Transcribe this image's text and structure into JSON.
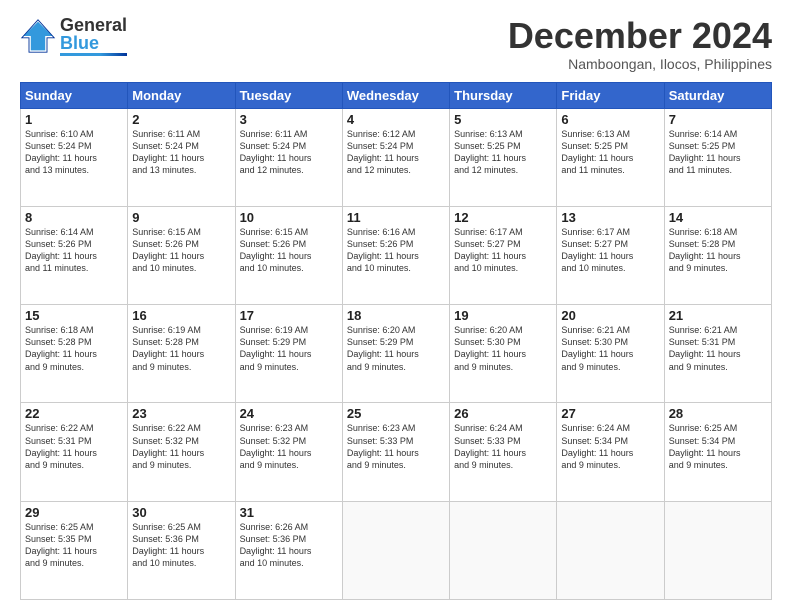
{
  "header": {
    "logo_general": "General",
    "logo_blue": "Blue",
    "month_title": "December 2024",
    "location": "Namboongan, Ilocos, Philippines"
  },
  "calendar": {
    "days_of_week": [
      "Sunday",
      "Monday",
      "Tuesday",
      "Wednesday",
      "Thursday",
      "Friday",
      "Saturday"
    ],
    "weeks": [
      [
        {
          "day": "",
          "info": ""
        },
        {
          "day": "2",
          "info": "Sunrise: 6:11 AM\nSunset: 5:24 PM\nDaylight: 11 hours\nand 13 minutes."
        },
        {
          "day": "3",
          "info": "Sunrise: 6:11 AM\nSunset: 5:24 PM\nDaylight: 11 hours\nand 12 minutes."
        },
        {
          "day": "4",
          "info": "Sunrise: 6:12 AM\nSunset: 5:24 PM\nDaylight: 11 hours\nand 12 minutes."
        },
        {
          "day": "5",
          "info": "Sunrise: 6:13 AM\nSunset: 5:25 PM\nDaylight: 11 hours\nand 12 minutes."
        },
        {
          "day": "6",
          "info": "Sunrise: 6:13 AM\nSunset: 5:25 PM\nDaylight: 11 hours\nand 11 minutes."
        },
        {
          "day": "7",
          "info": "Sunrise: 6:14 AM\nSunset: 5:25 PM\nDaylight: 11 hours\nand 11 minutes."
        }
      ],
      [
        {
          "day": "1",
          "info": "Sunrise: 6:10 AM\nSunset: 5:24 PM\nDaylight: 11 hours\nand 13 minutes."
        },
        {
          "day": "",
          "info": ""
        },
        {
          "day": "",
          "info": ""
        },
        {
          "day": "",
          "info": ""
        },
        {
          "day": "",
          "info": ""
        },
        {
          "day": "",
          "info": ""
        },
        {
          "day": "",
          "info": ""
        }
      ],
      [
        {
          "day": "8",
          "info": "Sunrise: 6:14 AM\nSunset: 5:26 PM\nDaylight: 11 hours\nand 11 minutes."
        },
        {
          "day": "9",
          "info": "Sunrise: 6:15 AM\nSunset: 5:26 PM\nDaylight: 11 hours\nand 10 minutes."
        },
        {
          "day": "10",
          "info": "Sunrise: 6:15 AM\nSunset: 5:26 PM\nDaylight: 11 hours\nand 10 minutes."
        },
        {
          "day": "11",
          "info": "Sunrise: 6:16 AM\nSunset: 5:26 PM\nDaylight: 11 hours\nand 10 minutes."
        },
        {
          "day": "12",
          "info": "Sunrise: 6:17 AM\nSunset: 5:27 PM\nDaylight: 11 hours\nand 10 minutes."
        },
        {
          "day": "13",
          "info": "Sunrise: 6:17 AM\nSunset: 5:27 PM\nDaylight: 11 hours\nand 10 minutes."
        },
        {
          "day": "14",
          "info": "Sunrise: 6:18 AM\nSunset: 5:28 PM\nDaylight: 11 hours\nand 9 minutes."
        }
      ],
      [
        {
          "day": "15",
          "info": "Sunrise: 6:18 AM\nSunset: 5:28 PM\nDaylight: 11 hours\nand 9 minutes."
        },
        {
          "day": "16",
          "info": "Sunrise: 6:19 AM\nSunset: 5:28 PM\nDaylight: 11 hours\nand 9 minutes."
        },
        {
          "day": "17",
          "info": "Sunrise: 6:19 AM\nSunset: 5:29 PM\nDaylight: 11 hours\nand 9 minutes."
        },
        {
          "day": "18",
          "info": "Sunrise: 6:20 AM\nSunset: 5:29 PM\nDaylight: 11 hours\nand 9 minutes."
        },
        {
          "day": "19",
          "info": "Sunrise: 6:20 AM\nSunset: 5:30 PM\nDaylight: 11 hours\nand 9 minutes."
        },
        {
          "day": "20",
          "info": "Sunrise: 6:21 AM\nSunset: 5:30 PM\nDaylight: 11 hours\nand 9 minutes."
        },
        {
          "day": "21",
          "info": "Sunrise: 6:21 AM\nSunset: 5:31 PM\nDaylight: 11 hours\nand 9 minutes."
        }
      ],
      [
        {
          "day": "22",
          "info": "Sunrise: 6:22 AM\nSunset: 5:31 PM\nDaylight: 11 hours\nand 9 minutes."
        },
        {
          "day": "23",
          "info": "Sunrise: 6:22 AM\nSunset: 5:32 PM\nDaylight: 11 hours\nand 9 minutes."
        },
        {
          "day": "24",
          "info": "Sunrise: 6:23 AM\nSunset: 5:32 PM\nDaylight: 11 hours\nand 9 minutes."
        },
        {
          "day": "25",
          "info": "Sunrise: 6:23 AM\nSunset: 5:33 PM\nDaylight: 11 hours\nand 9 minutes."
        },
        {
          "day": "26",
          "info": "Sunrise: 6:24 AM\nSunset: 5:33 PM\nDaylight: 11 hours\nand 9 minutes."
        },
        {
          "day": "27",
          "info": "Sunrise: 6:24 AM\nSunset: 5:34 PM\nDaylight: 11 hours\nand 9 minutes."
        },
        {
          "day": "28",
          "info": "Sunrise: 6:25 AM\nSunset: 5:34 PM\nDaylight: 11 hours\nand 9 minutes."
        }
      ],
      [
        {
          "day": "29",
          "info": "Sunrise: 6:25 AM\nSunset: 5:35 PM\nDaylight: 11 hours\nand 9 minutes."
        },
        {
          "day": "30",
          "info": "Sunrise: 6:25 AM\nSunset: 5:36 PM\nDaylight: 11 hours\nand 10 minutes."
        },
        {
          "day": "31",
          "info": "Sunrise: 6:26 AM\nSunset: 5:36 PM\nDaylight: 11 hours\nand 10 minutes."
        },
        {
          "day": "",
          "info": ""
        },
        {
          "day": "",
          "info": ""
        },
        {
          "day": "",
          "info": ""
        },
        {
          "day": "",
          "info": ""
        }
      ]
    ]
  }
}
